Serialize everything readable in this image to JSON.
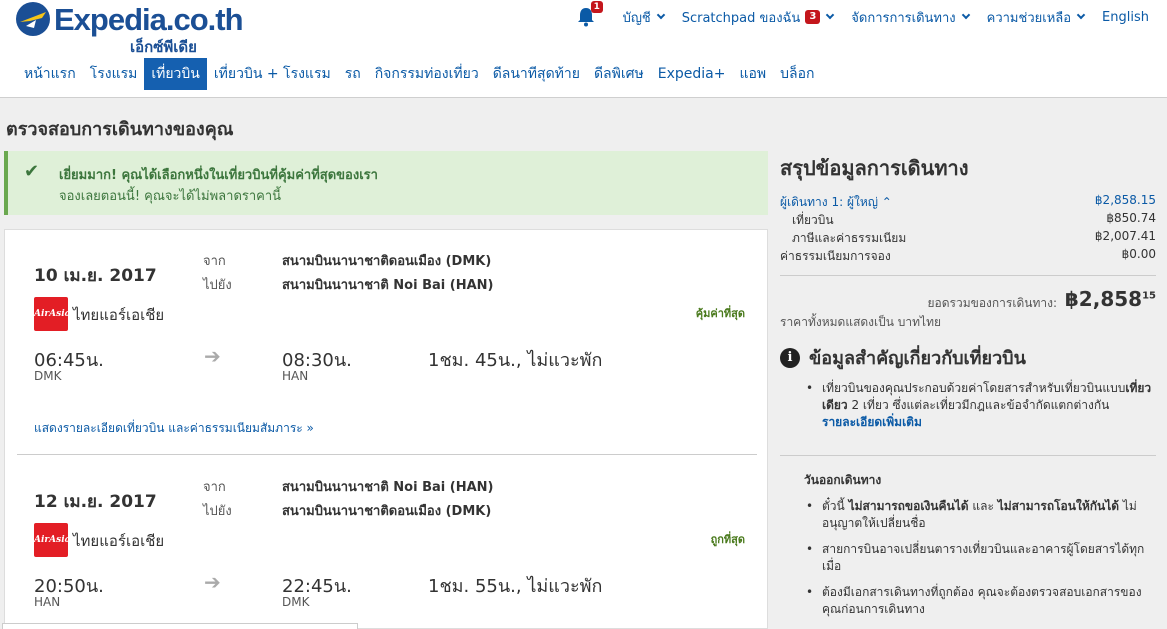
{
  "header": {
    "logo_text": "Expedia.co.th",
    "logo_sub": "เอ็กซ์พีเดีย",
    "notification_count": "1",
    "top_links": {
      "account": "บัญชี",
      "scratchpad": "Scratchpad ของฉัน",
      "scratchpad_count": "3",
      "manage_trips": "จัดการการเดินทาง",
      "help": "ความช่วยเหลือ",
      "language": "English"
    },
    "tabs": [
      {
        "label": "หน้าแรก",
        "active": false
      },
      {
        "label": "โรงแรม",
        "active": false
      },
      {
        "label": "เที่ยวบิน",
        "active": true
      },
      {
        "label": "เที่ยวบิน + โรงแรม",
        "active": false
      },
      {
        "label": "รถ",
        "active": false
      },
      {
        "label": "กิจกรรมท่องเที่ยว",
        "active": false
      },
      {
        "label": "ดีลนาทีสุดท้าย",
        "active": false
      },
      {
        "label": "ดีลพิเศษ",
        "active": false
      },
      {
        "label": "Expedia+",
        "active": false
      },
      {
        "label": "แอพ",
        "active": false
      },
      {
        "label": "บล็อก",
        "active": false
      }
    ]
  },
  "page": {
    "title": "ตรวจสอบการเดินทางของคุณ"
  },
  "banner": {
    "line1": "เยี่ยมมาก! คุณได้เลือกหนึ่งในเที่ยวบินที่คุ้มค่าที่สุดของเรา",
    "line2": "จองเลยตอนนี้! คุณจะได้ไม่พลาดราคานี้"
  },
  "flights": [
    {
      "date": "10 เม.ย. 2017",
      "from_label": "จาก",
      "to_label": "ไปยัง",
      "from_airport": "สนามบินนานาชาติดอนเมือง (DMK)",
      "to_airport": "สนามบินนานาชาติ Noi Bai (HAN)",
      "airline": "ไทยแอร์เอเชีย",
      "airline_logo": "AirAsia",
      "deal": "คุ้มค่าที่สุด",
      "depart_time": "06:45น.",
      "depart_code": "DMK",
      "arrive_time": "08:30น.",
      "arrive_code": "HAN",
      "duration": "1ชม. 45น., ไม่แวะพัก",
      "details_link": "แสดงรายละเอียดเที่ยวบิน และค่าธรรมเนียมสัมภาระ"
    },
    {
      "date": "12 เม.ย. 2017",
      "from_label": "จาก",
      "to_label": "ไปยัง",
      "from_airport": "สนามบินนานาชาติ Noi Bai (HAN)",
      "to_airport": "สนามบินนานาชาติดอนเมือง (DMK)",
      "airline": "ไทยแอร์เอเชีย",
      "airline_logo": "AirAsia",
      "deal": "ถูกที่สุด",
      "depart_time": "20:50น.",
      "depart_code": "HAN",
      "arrive_time": "22:45น.",
      "arrive_code": "DMK",
      "duration": "1ชม. 55น., ไม่แวะพัก"
    }
  ],
  "summary": {
    "title": "สรุปข้อมูลการเดินทาง",
    "traveler_label": "ผู้เดินทาง 1: ผู้ใหญ่",
    "traveler_amount": "฿2,858.15",
    "flight_label": "เที่ยวบิน",
    "flight_amount": "฿850.74",
    "tax_label": "ภาษีและค่าธรรมเนียม",
    "tax_amount": "฿2,007.41",
    "booking_fee_label": "ค่าธรรมเนียมการจอง",
    "booking_fee_amount": "฿0.00",
    "total_label": "ยอดรวมของการเดินทาง:",
    "total_main": "฿2,858",
    "total_decimal": "15",
    "currency_note": "ราคาทั้งหมดแสดงเป็น บาทไทย"
  },
  "info": {
    "title": "ข้อมูลสำคัญเกี่ยวกับเที่ยวบิน",
    "bullet1_a": "เที่ยวบินของคุณประกอบด้วยค่าโดยสารสำหรับเที่ยวบินแบบ",
    "bullet1_bold": "เที่ยวเดียว",
    "bullet1_b": " 2 เที่ยว ซึ่งแต่ละเที่ยวมีกฎและข้อจำกัดแตกต่างกัน",
    "bullet1_link": "รายละเอียดเพิ่มเติม",
    "section_head": "วันออกเดินทาง",
    "bullet2_a": "ตั๋วนี้ ",
    "bullet2_bold1": "ไม่สามารถขอเงินคืนได้",
    "bullet2_mid": " และ ",
    "bullet2_bold2": "ไม่สามารถโอนให้กันได้",
    "bullet2_b": " ไม่อนุญาตให้เปลี่ยนชื่อ",
    "bullet3": "สายการบินอาจเปลี่ยนตารางเที่ยวบินและอาคารผู้โดยสารได้ทุกเมื่อ",
    "bullet4": "ต้องมีเอกสารเดินทางที่ถูกต้อง คุณจะต้องตรวจสอบเอกสารของคุณก่อนการเดินทาง"
  }
}
